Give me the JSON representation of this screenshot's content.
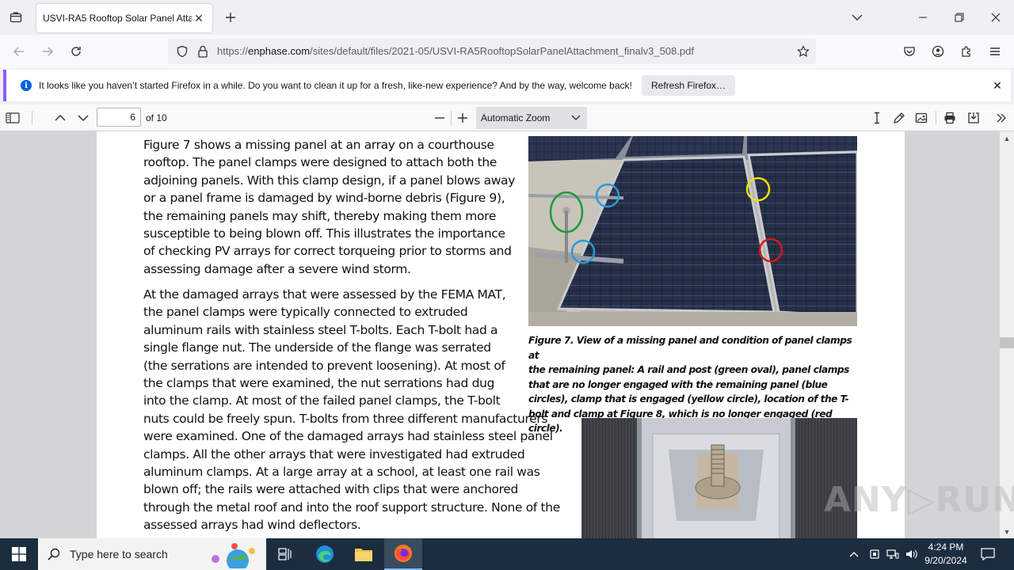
{
  "browser": {
    "tab": {
      "title": "USVI-RA5 Rooftop Solar Panel Attac"
    },
    "url": {
      "prefix": "https://",
      "host": "enphase.com",
      "path": "/sites/default/files/2021-05/USVI-RA5RooftopSolarPanelAttachment_finalv3_508.pdf"
    },
    "notification": {
      "message": "It looks like you haven’t started Firefox in a while. Do you want to clean it up for a fresh, like-new experience? And by the way, welcome back!",
      "button": "Refresh Firefox…"
    }
  },
  "pdf_toolbar": {
    "page_number": "6",
    "page_total": "of 10",
    "zoom": "Automatic Zoom"
  },
  "document": {
    "paragraph1": "Figure 7 shows a missing panel at an array on a courthouse\nrooftop. The panel clamps were designed to attach both the\nadjoining panels. With this clamp design, if a panel blows away\nor a panel frame is damaged by wind-borne debris (Figure 9),\nthe remaining panels may shift, thereby making them more\nsusceptible to being blown off. This illustrates the importance\nof checking PV arrays for correct torqueing prior to storms and\nassessing damage after a severe wind storm.",
    "paragraph2": "At the damaged arrays that were assessed by the FEMA MAT,\nthe panel clamps were typically connected to extruded\naluminum rails with stainless steel T-bolts. Each T-bolt had a\nsingle flange nut. The underside of the flange was serrated\n(the serrations are intended to prevent loosening). At most of\nthe clamps that were examined, the nut serrations had dug\ninto the clamp. At most of the failed panel clamps, the T-bolt\nnuts could be freely spun. T-bolts from three different manufacturers\nwere examined. One of the damaged arrays had stainless steel panel\nclamps. All the other arrays that were investigated had extruded\naluminum clamps. At a large array at a school, at least one rail was\nblown off; the rails were attached with clips that were anchored\nthrough the metal roof and into the roof support structure. None of the\nassessed arrays had wind deflectors.",
    "figure7_caption": "Figure 7. View of a missing panel and condition of panel clamps at\nthe remaining panel: A rail and post (green oval), panel clamps\nthat are no longer engaged with the remaining panel (blue\ncircles), clamp that is engaged (yellow circle), location of the T-\nbolt and clamp at Figure 8, which is no longer engaged (red circle)."
  },
  "watermark": "ANY▷RUN",
  "taskbar": {
    "search_placeholder": "Type here to search",
    "time": "4:24 PM",
    "date": "9/20/2024"
  },
  "colors": {
    "accent": "#9059ff",
    "info": "#0060df",
    "taskbar": "#1c2d3f",
    "oval_green": "#1a9a3a",
    "circle_blue": "#2a9ad8",
    "circle_yellow": "#f2e000",
    "circle_red": "#d81818"
  }
}
